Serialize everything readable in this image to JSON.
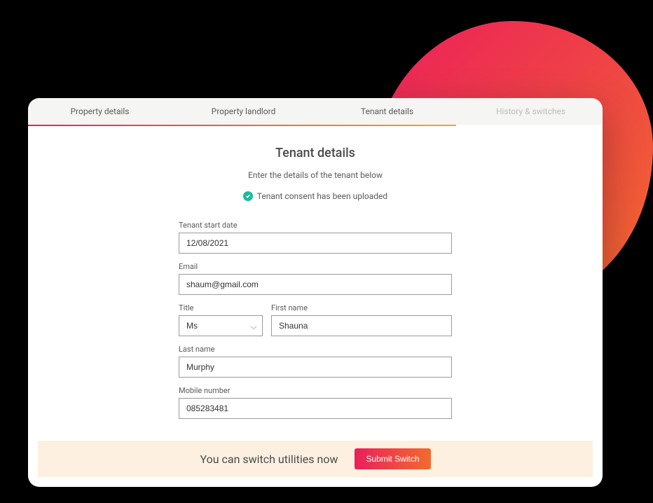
{
  "tabs": [
    {
      "label": "Property details"
    },
    {
      "label": "Property landlord"
    },
    {
      "label": "Tenant details"
    },
    {
      "label": "History & switches"
    }
  ],
  "heading": "Tenant details",
  "subheading": "Enter the details of the tenant below",
  "consent_text": "Tenant consent has been uploaded",
  "form": {
    "start_date_label": "Tenant start date",
    "start_date_value": "12/08/2021",
    "email_label": "Email",
    "email_value": "shaum@gmail.com",
    "title_label": "Title",
    "title_value": "Ms",
    "first_name_label": "First name",
    "first_name_value": "Shauna",
    "last_name_label": "Last name",
    "last_name_value": "Murphy",
    "mobile_label": "Mobile number",
    "mobile_value": "085283481"
  },
  "footer": {
    "text": "You can switch utilities now",
    "button_label": "Submit Switch"
  }
}
